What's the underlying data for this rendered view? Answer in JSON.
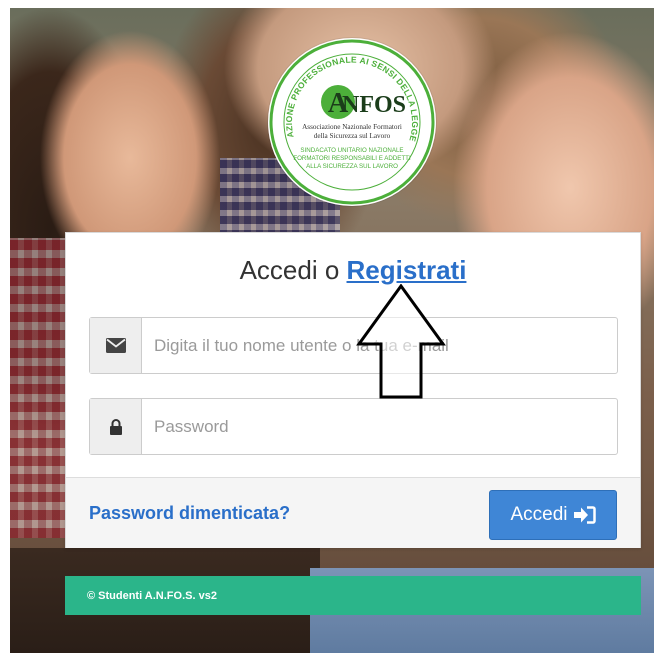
{
  "logo": {
    "ring_top": "ASSOCIAZIONE PROFESSIONALE AI SENSI DELLA LEGGE 4/2013",
    "acronym_a": "A",
    "acronym_rest": "NFOS",
    "subtitle_line1": "Associazione Nazionale Formatori",
    "subtitle_line2": "della Sicurezza sul Lavoro",
    "green_line1": "SINDACATO UNITARIO NAZIONALE",
    "green_line2": "FORMATORI RESPONSABILI E ADDETTI",
    "green_line3": "ALLA SICUREZZA SUL LAVORO"
  },
  "login": {
    "title_prefix": "Accedi o ",
    "register_link": "Registrati",
    "username_placeholder": "Digita il tuo nome utente o la tua e-mail",
    "password_placeholder": "Password",
    "forgot_password": "Password dimenticata?",
    "submit_label": "Accedi"
  },
  "footer": {
    "text": "© Studenti A.N.FO.S. vs2"
  },
  "colors": {
    "link": "#2a6fc9",
    "primary_button": "#3f86d6",
    "footer_bar": "#2bb58a",
    "logo_green": "#4caf3a"
  },
  "icons": {
    "username": "envelope-icon",
    "password": "lock-icon",
    "submit": "sign-in-icon"
  }
}
